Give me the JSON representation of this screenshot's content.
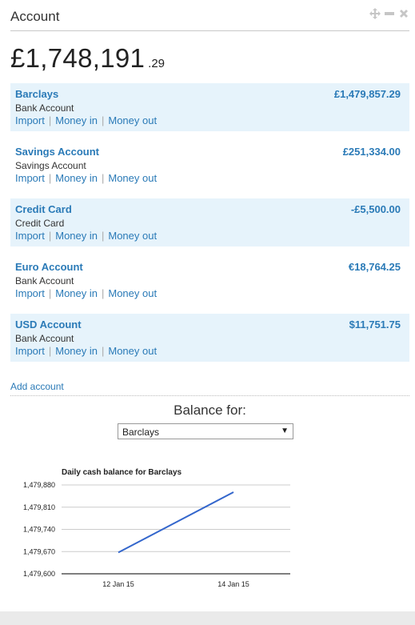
{
  "header": {
    "title": "Account",
    "controls": [
      "move-icon",
      "minimize-icon",
      "close-icon"
    ]
  },
  "total": {
    "main": "£1,748,191",
    "cents": ".29"
  },
  "accounts": [
    {
      "name": "Barclays",
      "type": "Bank Account",
      "balance": "£1,479,857.29",
      "shaded": true
    },
    {
      "name": "Savings Account",
      "type": "Savings Account",
      "balance": "£251,334.00",
      "shaded": false
    },
    {
      "name": "Credit Card",
      "type": "Credit Card",
      "balance": "-£5,500.00",
      "shaded": true
    },
    {
      "name": "Euro Account",
      "type": "Bank Account",
      "balance": "€18,764.25",
      "shaded": false
    },
    {
      "name": "USD Account",
      "type": "Bank Account",
      "balance": "$11,751.75",
      "shaded": true
    }
  ],
  "account_links": {
    "import": "Import",
    "money_in": "Money in",
    "money_out": "Money out"
  },
  "add_account": "Add account",
  "balance_for": {
    "label": "Balance for:",
    "selected": "Barclays"
  },
  "colors": {
    "link": "#2a7ab7",
    "shade": "#e6f3fb",
    "line": "#3366cc"
  },
  "chart_data": {
    "type": "line",
    "title": "Daily cash balance for Barclays",
    "x": [
      "12 Jan 15",
      "14 Jan 15"
    ],
    "series": [
      {
        "values": [
          1479667,
          1479857.29
        ]
      }
    ],
    "yticks": [
      "1,479,600",
      "1,479,670",
      "1,479,740",
      "1,479,810",
      "1,479,880"
    ],
    "ylim": [
      1479600,
      1479880
    ],
    "grid": true
  }
}
